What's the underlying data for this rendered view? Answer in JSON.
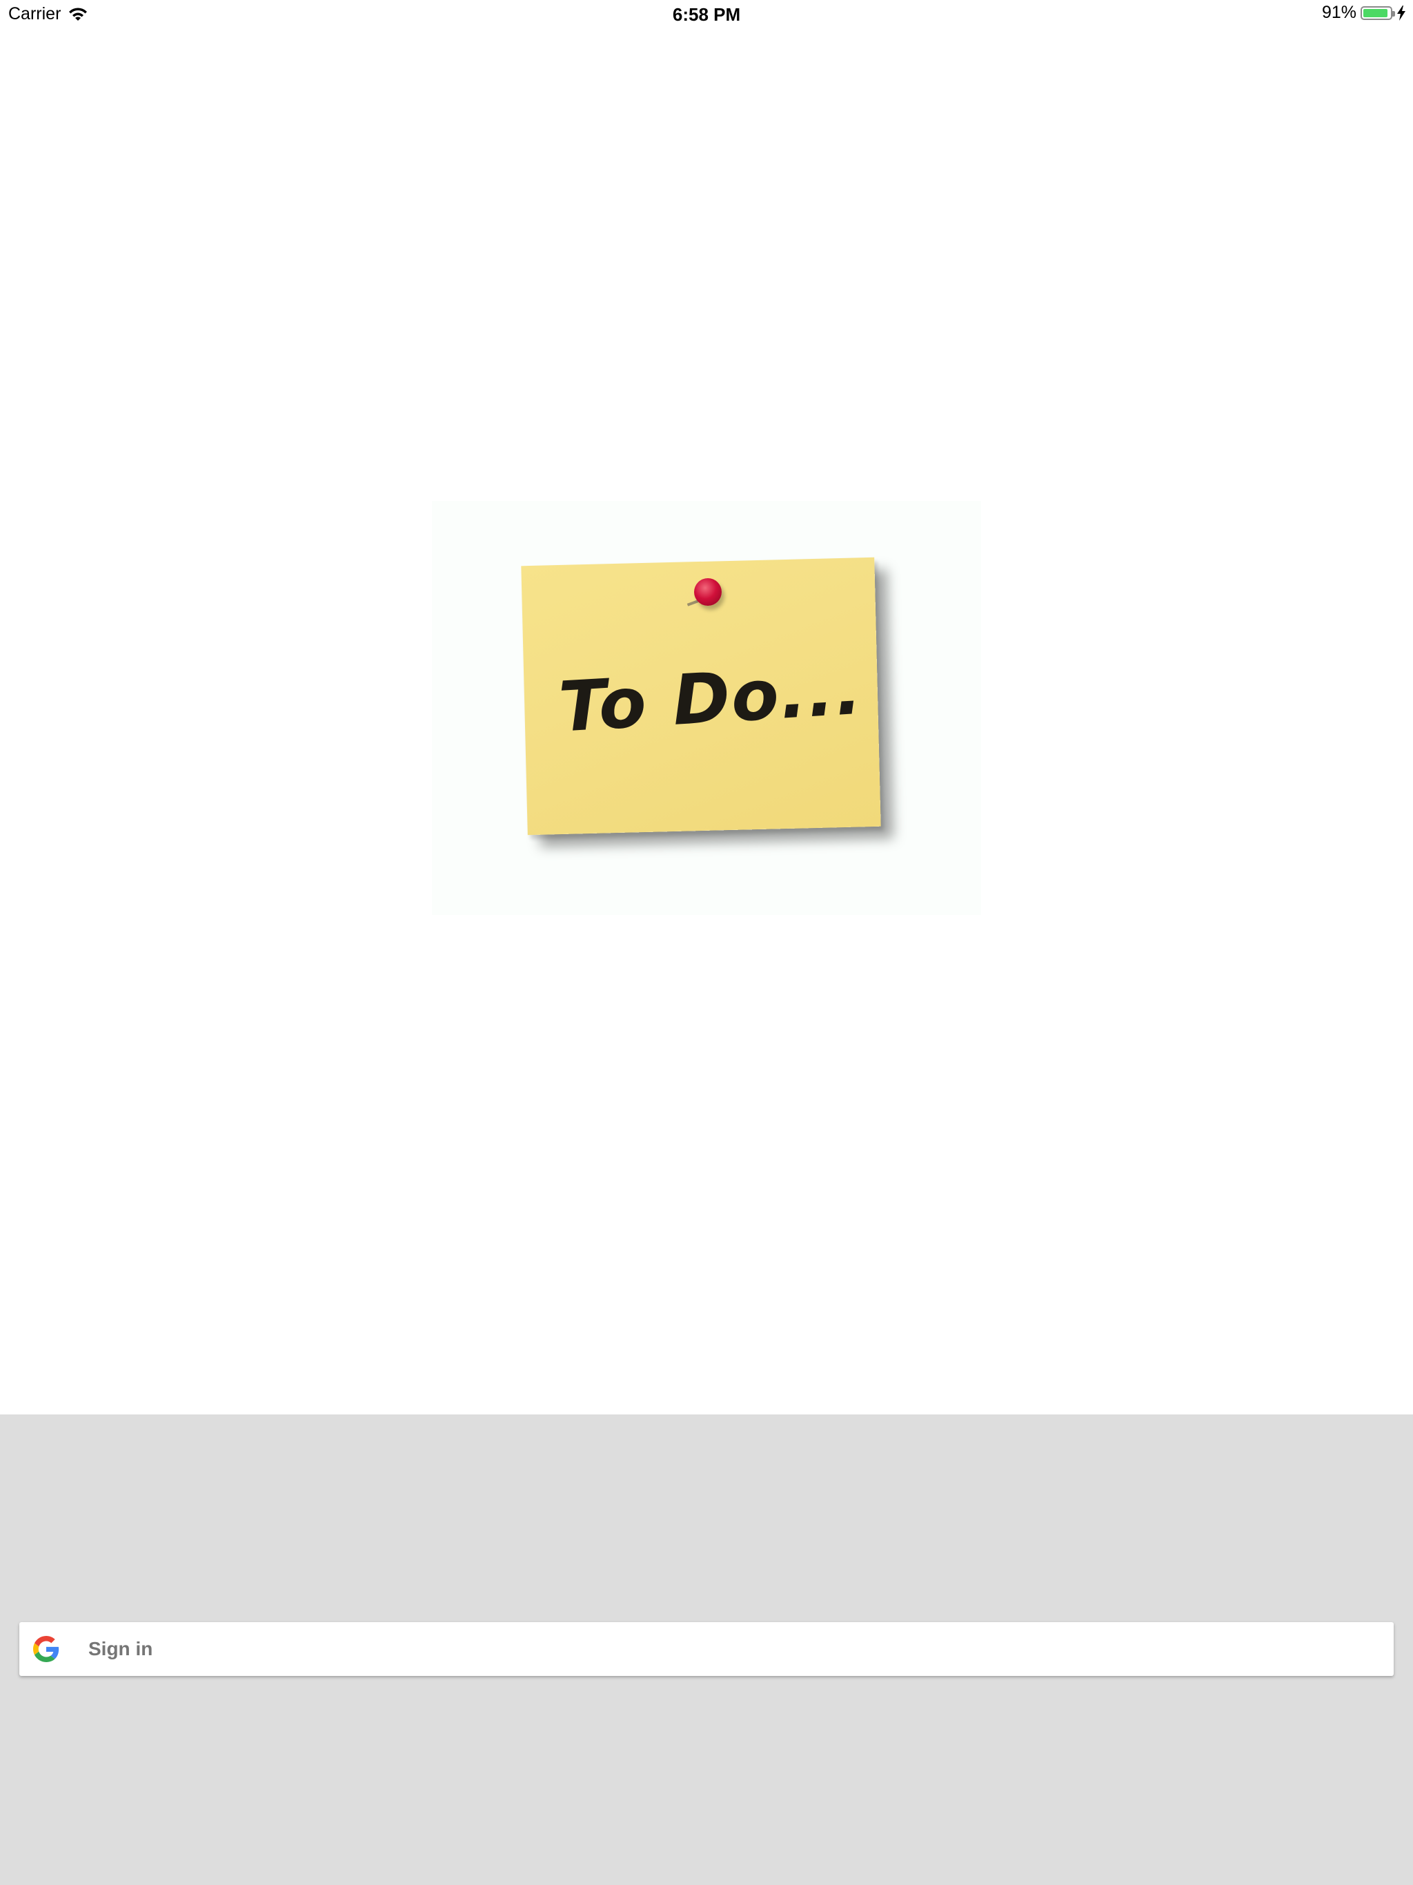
{
  "status_bar": {
    "carrier": "Carrier",
    "time": "6:58 PM",
    "battery_percent_text": "91%",
    "battery_level": 0.91,
    "charging": true
  },
  "hero_image": {
    "note_text": "To Do..."
  },
  "signin": {
    "label": "Sign in",
    "icon": "google-g-icon"
  },
  "colors": {
    "lower_panel_bg": "#dddddd",
    "battery_green": "#4cd964",
    "sticky_yellow": "#f4df86",
    "pin_red": "#d0103a"
  }
}
